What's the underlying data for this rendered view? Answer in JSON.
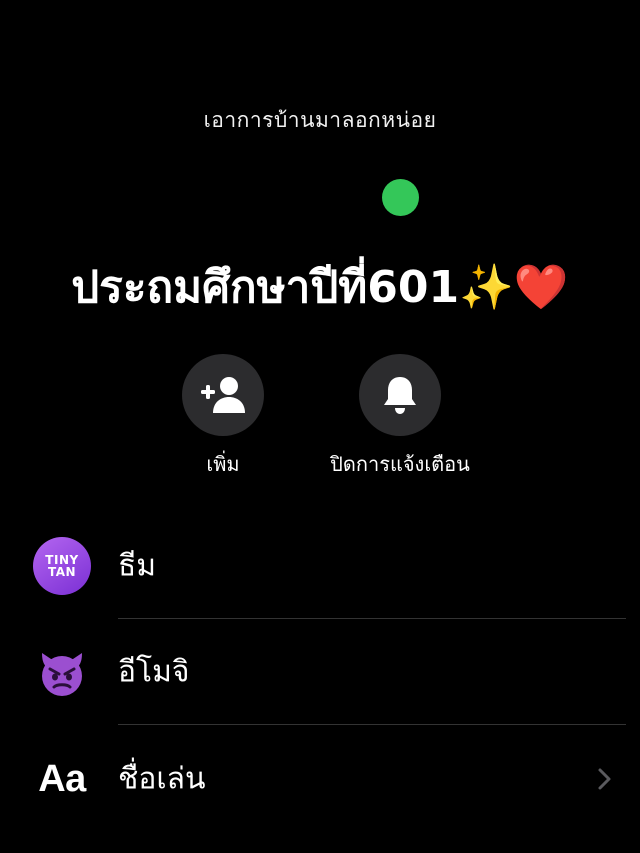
{
  "header": {
    "status_text": "เอาการบ้านมาลอกหน่อย",
    "online_color": "#34c759",
    "group_name": "ประถมศึกษาปีที่601✨❤️"
  },
  "actions": [
    {
      "label": "เพิ่ม",
      "icon": "add-person-icon"
    },
    {
      "label": "ปิดการแจ้งเตือน",
      "icon": "bell-icon"
    }
  ],
  "settings": [
    {
      "label": "ธีม",
      "icon": "theme-badge-icon",
      "badge_text": "TINY TAN"
    },
    {
      "label": "อีโมจิ",
      "icon": "devil-emoji-icon",
      "emoji": "😈"
    },
    {
      "label": "ชื่อเล่น",
      "icon": "text-aa-icon",
      "icon_text": "Aa",
      "chevron": "chevron-right-icon"
    }
  ]
}
